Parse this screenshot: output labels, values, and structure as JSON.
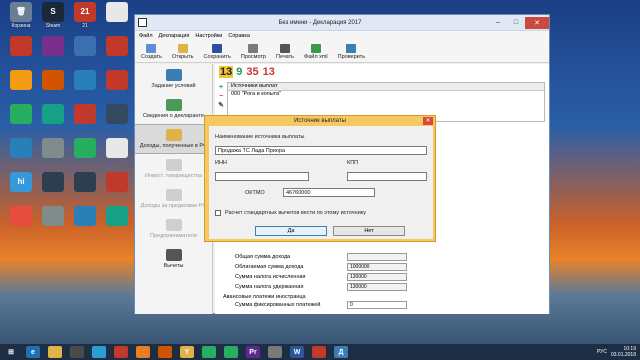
{
  "desktop": [
    {
      "label": "Корзина",
      "glyph": "🗑",
      "bg": "#6a7f96"
    },
    {
      "label": "Steam",
      "glyph": "S",
      "bg": "#1b2838"
    },
    {
      "label": "21",
      "glyph": "21",
      "bg": "#c0392b"
    },
    {
      "label": "",
      "glyph": "",
      "bg": "#e8e8e8"
    },
    {
      "label": "",
      "glyph": "",
      "bg": "#c0392b"
    },
    {
      "label": "",
      "glyph": "",
      "bg": "#7a2f8c"
    },
    {
      "label": "",
      "glyph": "",
      "bg": "#3a6fb0"
    },
    {
      "label": "",
      "glyph": "",
      "bg": "#c0392b"
    },
    {
      "label": "",
      "glyph": "",
      "bg": "#f39c12"
    },
    {
      "label": "",
      "glyph": "",
      "bg": "#d35400"
    },
    {
      "label": "",
      "glyph": "",
      "bg": "#2980b9"
    },
    {
      "label": "",
      "glyph": "",
      "bg": "#c0392b"
    },
    {
      "label": "",
      "glyph": "",
      "bg": "#27ae60"
    },
    {
      "label": "",
      "glyph": "",
      "bg": "#16a085"
    },
    {
      "label": "",
      "glyph": "",
      "bg": "#c0392b"
    },
    {
      "label": "",
      "glyph": "",
      "bg": "#34495e"
    },
    {
      "label": "",
      "glyph": "",
      "bg": "#2980b9"
    },
    {
      "label": "",
      "glyph": "",
      "bg": "#7f8c8d"
    },
    {
      "label": "",
      "glyph": "",
      "bg": "#27ae60"
    },
    {
      "label": "",
      "glyph": "",
      "bg": "#e8e8e8"
    },
    {
      "label": "",
      "glyph": "hi",
      "bg": "#3498db"
    },
    {
      "label": "",
      "glyph": "",
      "bg": "#2c3e50"
    },
    {
      "label": "",
      "glyph": "",
      "bg": "#2c3e50"
    },
    {
      "label": "",
      "glyph": "",
      "bg": "#c0392b"
    },
    {
      "label": "",
      "glyph": "",
      "bg": "#e74c3c"
    },
    {
      "label": "",
      "glyph": "",
      "bg": "#7f8c8d"
    },
    {
      "label": "",
      "glyph": "",
      "bg": "#2980b9"
    },
    {
      "label": "",
      "glyph": "",
      "bg": "#16a085"
    }
  ],
  "window": {
    "title": "Без имени - Декларация 2017",
    "menu": [
      "Файл",
      "Декларация",
      "Настройки",
      "Справка"
    ],
    "toolbar": [
      {
        "label": "Создать",
        "color": "#5b8fd6"
      },
      {
        "label": "Открыть",
        "color": "#e0b34a"
      },
      {
        "label": "Сохранить",
        "color": "#2d4fa0"
      },
      {
        "label": "Просмотр",
        "color": "#7a7a7a"
      },
      {
        "label": "Печать",
        "color": "#555"
      },
      {
        "label": "Файл xml",
        "color": "#3a9a4a"
      },
      {
        "label": "Проверить",
        "color": "#3a7fb3"
      }
    ],
    "nav": [
      {
        "label": "Задание условий",
        "color": "#3a7fb3",
        "state": "normal"
      },
      {
        "label": "Сведения о декларанте",
        "color": "#4a9a5a",
        "state": "normal"
      },
      {
        "label": "Доходы, полученные в РФ",
        "color": "#e0b34a",
        "state": "active"
      },
      {
        "label": "Инвест. товарищества",
        "color": "#cfcfcf",
        "state": "dim"
      },
      {
        "label": "Доходы за пределами РФ",
        "color": "#cfcfcf",
        "state": "dim"
      },
      {
        "label": "Предприниматели",
        "color": "#cfcfcf",
        "state": "dim"
      },
      {
        "label": "Вычеты",
        "color": "#555",
        "state": "normal"
      }
    ],
    "tabs": [
      {
        "label": "13",
        "color": "#222",
        "bg": "#f2c23a"
      },
      {
        "label": "9",
        "color": "#2aa14a",
        "bg": "transparent"
      },
      {
        "label": "35",
        "color": "#c33",
        "bg": "transparent"
      },
      {
        "label": "13",
        "color": "#c33",
        "bg": "transparent"
      }
    ],
    "sources": {
      "header": "Источники выплат",
      "rows": [
        "000 \"Рога и копыта\""
      ]
    },
    "totals": [
      {
        "label": "Общая сумма дохода",
        "value": ""
      },
      {
        "label": "Облагаемая сумма дохода",
        "value": "1000000"
      },
      {
        "label": "Сумма налога исчисленная",
        "value": "130000"
      },
      {
        "label": "Сумма налога удержанная",
        "value": "130000"
      }
    ],
    "advance": {
      "title": "Авансовые платежи иностранца",
      "label": "Сумма фиксированных платежей",
      "value": "0"
    }
  },
  "dialog": {
    "title": "Источник выплаты",
    "name_label": "Наименование источника выплаты",
    "name_value": "Продажа ТС Лада Приора",
    "inn_label": "ИНН",
    "inn_value": "",
    "kpp_label": "КПП",
    "kpp_value": "",
    "oktmo_label": "ОКТМО",
    "oktmo_value": "46760000",
    "checkbox_label": "Расчет стандартных вычетов вести по этому источнику",
    "yes_label": "Да",
    "no_label": "Нет"
  },
  "taskbar": {
    "apps": [
      {
        "glyph": "⊞",
        "bg": "transparent"
      },
      {
        "glyph": "e",
        "bg": "#1f6fb5"
      },
      {
        "glyph": "",
        "bg": "#e0b34a"
      },
      {
        "glyph": "",
        "bg": "#4a4a4a"
      },
      {
        "glyph": "",
        "bg": "#2a9fd6"
      },
      {
        "glyph": "",
        "bg": "#c0392b"
      },
      {
        "glyph": "",
        "bg": "#e67e22"
      },
      {
        "glyph": "",
        "bg": "#d35400"
      },
      {
        "glyph": "Y",
        "bg": "#e0b34a"
      },
      {
        "glyph": "",
        "bg": "#27ae60"
      },
      {
        "glyph": "",
        "bg": "#27ae60"
      },
      {
        "glyph": "Pr",
        "bg": "#5b2b8c"
      },
      {
        "glyph": "",
        "bg": "#7a7a7a"
      },
      {
        "glyph": "W",
        "bg": "#2b5797"
      },
      {
        "glyph": "",
        "bg": "#c0392b"
      },
      {
        "glyph": "Д",
        "bg": "#3a7fb3"
      }
    ],
    "lang": "РУС",
    "time": "10:19",
    "date": "03.01.2018"
  }
}
